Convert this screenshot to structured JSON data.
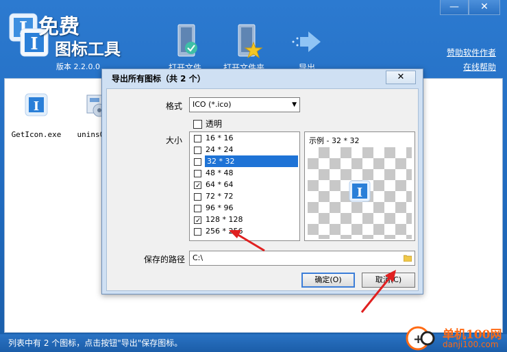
{
  "app": {
    "logo_line1": "免费",
    "logo_line2": "图标工具",
    "version": "版本 2.2.0.0",
    "window_controls": {
      "minimize": "—",
      "close": "✕"
    },
    "toolbar": {
      "open_file": "打开文件",
      "open_folder": "打开文件夹",
      "export": "导出"
    },
    "links": {
      "sponsor": "赞助软件作者",
      "help": "在线帮助"
    },
    "files": [
      {
        "name": "GetIcon.exe",
        "icon": "app-icon"
      },
      {
        "name": "unins000",
        "icon": "installer-icon"
      }
    ],
    "status": "列表中有 2 个图标，点击按钮\"导出\"保存图标。",
    "watermark": {
      "text": "单机100网",
      "url": "danji100.com"
    }
  },
  "dialog": {
    "title": "导出所有图标（共 2 个）",
    "close": "✕",
    "format_label": "格式",
    "format_value": "ICO (*.ico)",
    "transparent_label": "透明",
    "size_label": "大小",
    "sizes": [
      {
        "label": "16 * 16",
        "checked": false,
        "selected": false
      },
      {
        "label": "24 * 24",
        "checked": false,
        "selected": false
      },
      {
        "label": "32 * 32",
        "checked": false,
        "selected": true
      },
      {
        "label": "48 * 48",
        "checked": false,
        "selected": false
      },
      {
        "label": "64 * 64",
        "checked": true,
        "selected": false
      },
      {
        "label": "72 * 72",
        "checked": false,
        "selected": false
      },
      {
        "label": "96 * 96",
        "checked": false,
        "selected": false
      },
      {
        "label": "128 * 128",
        "checked": true,
        "selected": false
      },
      {
        "label": "256 * 256",
        "checked": false,
        "selected": false
      }
    ],
    "preview_title": "示例 - 32 * 32",
    "path_label": "保存的路径",
    "path_value": "C:\\",
    "ok_button": "确定(O)",
    "cancel_button": "取消(C)"
  },
  "colors": {
    "titlebar": "#2c7ad0",
    "selection": "#1e73d6",
    "annotation": "#e02020",
    "watermark": "#ff6a13"
  }
}
